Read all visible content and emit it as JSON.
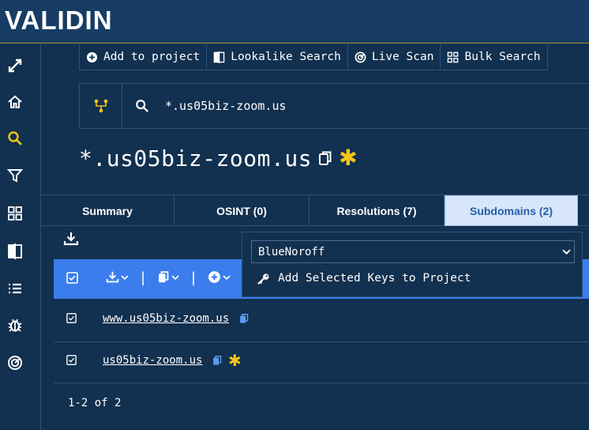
{
  "brand": {
    "logo_text": "VALIDIN"
  },
  "sidebar": {
    "icons": [
      "expand-icon",
      "home-icon",
      "search-icon",
      "filter-icon",
      "grid-icon",
      "compare-icon",
      "list-icon",
      "bug-icon",
      "target-icon"
    ],
    "active": "search-icon",
    "active_color": "#f5c518"
  },
  "toolbar": {
    "add_to_project": "Add to project",
    "lookalike_search": "Lookalike Search",
    "live_scan": "Live Scan",
    "bulk_search": "Bulk Search"
  },
  "search": {
    "value": "*.us05biz-zoom.us"
  },
  "page": {
    "title": "*.us05biz-zoom.us"
  },
  "tabs": [
    {
      "label": "Summary",
      "active": false
    },
    {
      "label": "OSINT (0)",
      "active": false
    },
    {
      "label": "Resolutions (7)",
      "active": false
    },
    {
      "label": "Subdomains (2)",
      "active": true
    }
  ],
  "popover": {
    "project_select": "BlueNoroff",
    "add_keys_label": "Add Selected Keys to Project"
  },
  "rows": [
    {
      "domain": "www.us05biz-zoom.us",
      "checked": true,
      "starred": false
    },
    {
      "domain": "us05biz-zoom.us",
      "checked": true,
      "starred": true
    }
  ],
  "pager": {
    "text": "1-2 of 2"
  },
  "colors": {
    "accent_blue": "#3b7ded",
    "star_yellow": "#f5c518",
    "background": "#12304f",
    "header": "#173d64"
  }
}
